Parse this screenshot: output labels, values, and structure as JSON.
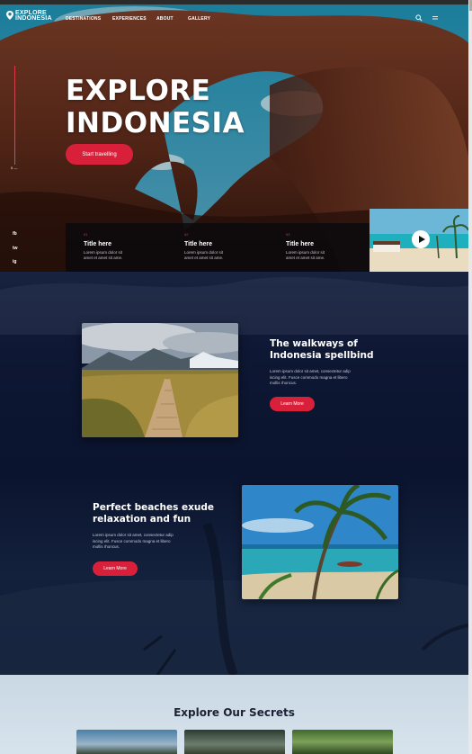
{
  "nav": {
    "logo_line1": "EXPLORE",
    "logo_line2": "INDONESIA",
    "links": [
      "DESTINATIONS",
      "EXPERIENCES",
      "ABOUT",
      "GALLERY"
    ],
    "icons": [
      "search-icon",
      "menu-icon"
    ]
  },
  "hero": {
    "title_line1": "EXPLORE",
    "title_line2": "INDONESIA",
    "button": "Start travelling",
    "counter": "0 —",
    "social": [
      "fb",
      "tw",
      "ig"
    ]
  },
  "cards": [
    {
      "num": "01",
      "title": "Title here",
      "text_line1": "Lorem ipsum dolor sit",
      "text_line2": "amet et amet sit ame."
    },
    {
      "num": "02",
      "title": "Title here",
      "text_line1": "Lorem ipsum dolor sit",
      "text_line2": "amet et amet sit ame."
    },
    {
      "num": "03",
      "title": "Title here",
      "text_line1": "Lorem ipsum dolor sit",
      "text_line2": "amet et amet sit ame."
    }
  ],
  "section1": {
    "title_line1": "The walkways of",
    "title_line2": "Indonesia spellbind",
    "text_line1": "Lorem ipsum dolor sit amet, consectetur adip",
    "text_line2": "iscing elit. Fusce commodo magna et libero",
    "text_line3": "mollis rhoncus.",
    "button": "Learn More"
  },
  "section2": {
    "title_line1": "Perfect beaches exude",
    "title_line2": "relaxation and fun",
    "text_line1": "Lorem ipsum dolor sit amet, consectetur adip",
    "text_line2": "iscing elit. Fusce commodo magna et libero",
    "text_line3": "mollis rhoncus.",
    "button": "Learn More"
  },
  "explore": {
    "title": "Explore Our Secrets"
  },
  "colors": {
    "accent": "#d8203a",
    "dark_bg": "#0e1733",
    "light_bg": "#d3e0e9"
  }
}
